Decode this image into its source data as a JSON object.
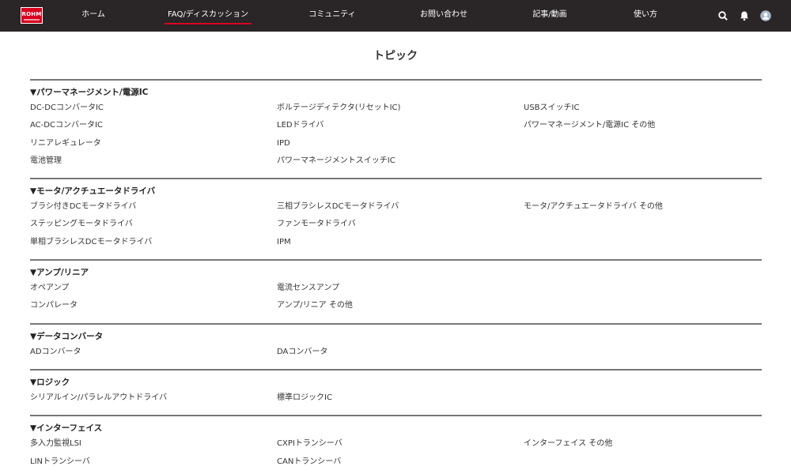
{
  "brand": {
    "logo_text": "ROHM"
  },
  "nav": {
    "items": [
      {
        "label": "ホーム"
      },
      {
        "label": "FAQ/ディスカッション"
      },
      {
        "label": "コミュニティ"
      },
      {
        "label": "お問い合わせ"
      },
      {
        "label": "記事/動画"
      },
      {
        "label": "使い方"
      }
    ],
    "active_index": 1
  },
  "page": {
    "title": "トピック"
  },
  "sections": [
    {
      "title": "▼パワーマネージメント/電源IC",
      "columns": [
        [
          "DC-DCコンバータIC",
          "AC-DCコンバータIC",
          "リニアレギュレータ",
          "電池管理"
        ],
        [
          "ボルテージディテクタ(リセットIC)",
          "LEDドライバ",
          "IPD",
          "パワーマネージメントスイッチIC"
        ],
        [
          "USBスイッチIC",
          "パワーマネージメント/電源IC その他"
        ]
      ]
    },
    {
      "title": "▼モータ/アクチュエータドライバ",
      "columns": [
        [
          "ブラシ付きDCモータドライバ",
          "ステッピングモータドライバ",
          "単相ブラシレスDCモータドライバ"
        ],
        [
          "三相ブラシレスDCモータドライバ",
          "ファンモータドライバ",
          "IPM"
        ],
        [
          "モータ/アクチュエータドライバ その他"
        ]
      ]
    },
    {
      "title": "▼アンプ/リニア",
      "columns": [
        [
          "オペアンプ",
          "コンパレータ"
        ],
        [
          "電流センスアンプ",
          "アンプ/リニア その他"
        ],
        []
      ]
    },
    {
      "title": "▼データコンバータ",
      "columns": [
        [
          "ADコンバータ"
        ],
        [
          "DAコンバータ"
        ],
        []
      ]
    },
    {
      "title": "▼ロジック",
      "columns": [
        [
          "シリアルイン/パラレルアウトドライバ"
        ],
        [
          "標準ロジックIC"
        ],
        []
      ]
    },
    {
      "title": "▼インターフェイス",
      "columns": [
        [
          "多入力監視LSI",
          "LINトランシーバ"
        ],
        [
          "CXPIトランシーバ",
          "CANトランシーバ"
        ],
        [
          "インターフェイス その他"
        ]
      ]
    }
  ],
  "colors": {
    "topbar": "#2a2527",
    "accent": "#d8001e",
    "divider": "#777777"
  },
  "icons": [
    "search-icon",
    "bell-icon",
    "user-avatar-icon"
  ]
}
